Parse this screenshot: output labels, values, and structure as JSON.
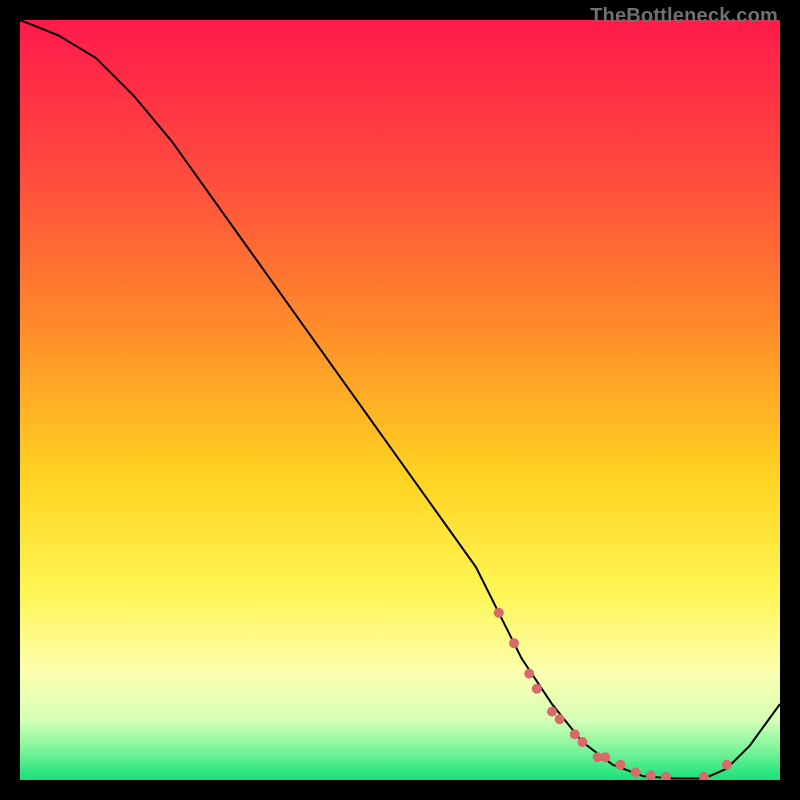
{
  "watermark": "TheBottleneck.com",
  "chart_data": {
    "type": "line",
    "title": "",
    "xlabel": "",
    "ylabel": "",
    "xlim": [
      0,
      100
    ],
    "ylim": [
      0,
      100
    ],
    "grid": false,
    "legend": false,
    "background_gradient": {
      "stops": [
        {
          "offset": 0.0,
          "color": "#ff1a4b"
        },
        {
          "offset": 0.2,
          "color": "#ff4a3e"
        },
        {
          "offset": 0.4,
          "color": "#ff8a2a"
        },
        {
          "offset": 0.6,
          "color": "#ffd321"
        },
        {
          "offset": 0.75,
          "color": "#fff552"
        },
        {
          "offset": 0.86,
          "color": "#fcffb0"
        },
        {
          "offset": 0.92,
          "color": "#d7ffb6"
        },
        {
          "offset": 0.96,
          "color": "#7cf59a"
        },
        {
          "offset": 1.0,
          "color": "#16e07a"
        }
      ]
    },
    "series": [
      {
        "name": "bottleneck-curve",
        "color": "#000000",
        "x": [
          0,
          5,
          10,
          15,
          20,
          25,
          30,
          35,
          40,
          45,
          50,
          55,
          60,
          63,
          66,
          70,
          74,
          78,
          82,
          86,
          90,
          93,
          96,
          100
        ],
        "y": [
          100,
          98,
          95,
          90,
          84,
          77,
          70,
          63,
          56,
          49,
          42,
          35,
          28,
          22,
          16,
          10,
          5,
          2,
          0.5,
          0.2,
          0.2,
          1.5,
          4.5,
          10
        ]
      }
    ],
    "markers": {
      "name": "highlight-dots",
      "color": "#d86a6a",
      "radius": 5,
      "x": [
        63,
        65,
        67,
        68,
        70,
        71,
        73,
        74,
        76,
        77,
        79,
        81,
        83,
        85,
        90,
        93
      ],
      "y": [
        22,
        18,
        14,
        12,
        9,
        8,
        6,
        5,
        3,
        3,
        2,
        1,
        0.6,
        0.4,
        0.4,
        2.0
      ]
    }
  }
}
